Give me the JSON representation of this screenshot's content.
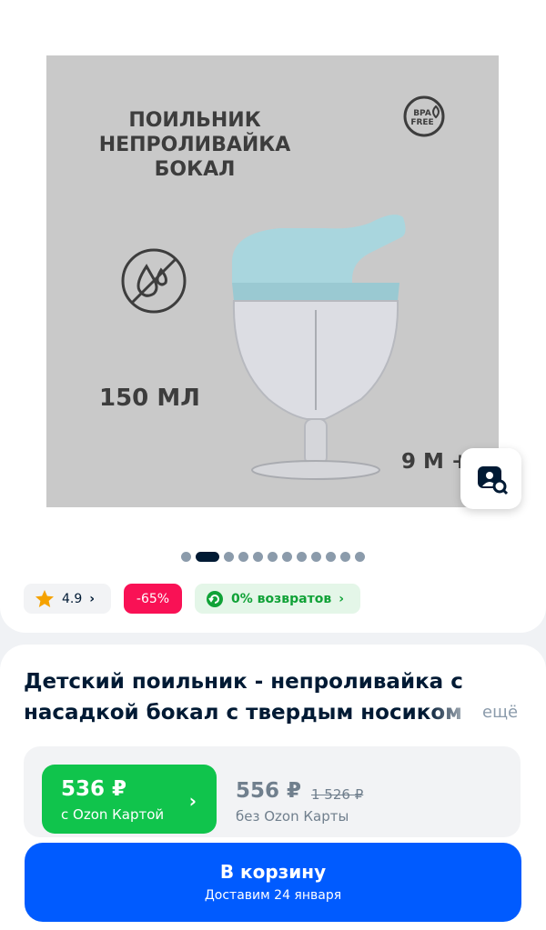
{
  "image": {
    "title_lines": [
      "ПОИЛЬНИК",
      "НЕПРОЛИВАЙКА",
      "БОКАЛ"
    ],
    "volume": "150 МЛ",
    "age": "9 М +",
    "badge_top": "BPA",
    "badge_bottom": "FREE",
    "background_color": "#c9c9c9",
    "image_count": 12,
    "active_image": 2
  },
  "chips": {
    "rating": "4.9",
    "discount": "-65%",
    "returns": "0% возвратов"
  },
  "product": {
    "title": "Детский поильник - непроливайка с насадкой бокал с твердым носиком",
    "more": "ещё"
  },
  "price": {
    "ozon_price": "536 ₽",
    "ozon_label": "с Ozon Картой",
    "regular_price": "556 ₽",
    "old_price": "1 526 ₽",
    "regular_label": "без Ozon Карты"
  },
  "cart": {
    "label": "В корзину",
    "delivery": "Доставим 24 января"
  },
  "colors": {
    "accent_blue": "#005bff",
    "ozon_green": "#10c44c",
    "discount_pink": "#f91155"
  }
}
